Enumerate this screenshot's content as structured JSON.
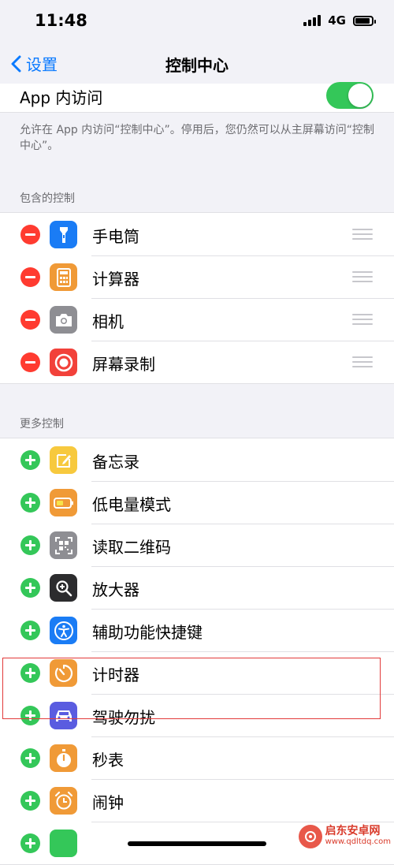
{
  "status": {
    "time": "11:48",
    "network": "4G"
  },
  "nav": {
    "back_label": "设置",
    "title": "控制中心"
  },
  "access": {
    "label": "App 内访问",
    "enabled": true,
    "note": "允许在 App 内访问“控制中心”。停用后，您仍然可以从主屏幕访问“控制中心”。"
  },
  "included": {
    "header": "包含的控制",
    "items": [
      {
        "label": "手电筒",
        "icon": "flashlight-icon",
        "color": "#1a7cf5"
      },
      {
        "label": "计算器",
        "icon": "calculator-icon",
        "color": "#f09a37"
      },
      {
        "label": "相机",
        "icon": "camera-icon",
        "color": "#8e8e93"
      },
      {
        "label": "屏幕录制",
        "icon": "screen-record-icon",
        "color": "#f2413a"
      }
    ]
  },
  "more": {
    "header": "更多控制",
    "items": [
      {
        "label": "备忘录",
        "icon": "notes-icon",
        "color": "#f7c93e"
      },
      {
        "label": "低电量模式",
        "icon": "low-power-icon",
        "color": "#f09a37"
      },
      {
        "label": "读取二维码",
        "icon": "qr-code-icon",
        "color": "#8e8e93"
      },
      {
        "label": "放大器",
        "icon": "magnifier-icon",
        "color": "#2c2c2e"
      },
      {
        "label": "辅助功能快捷键",
        "icon": "accessibility-icon",
        "color": "#1a7cf5"
      },
      {
        "label": "计时器",
        "icon": "timer-icon",
        "color": "#f09a37"
      },
      {
        "label": "驾驶勿扰",
        "icon": "car-icon",
        "color": "#5a5ce0"
      },
      {
        "label": "秒表",
        "icon": "stopwatch-icon",
        "color": "#f09a37"
      },
      {
        "label": "闹钟",
        "icon": "alarm-icon",
        "color": "#f09a37"
      }
    ]
  },
  "watermark": {
    "name": "启东安卓网",
    "url": "www.qdltdq.com"
  }
}
